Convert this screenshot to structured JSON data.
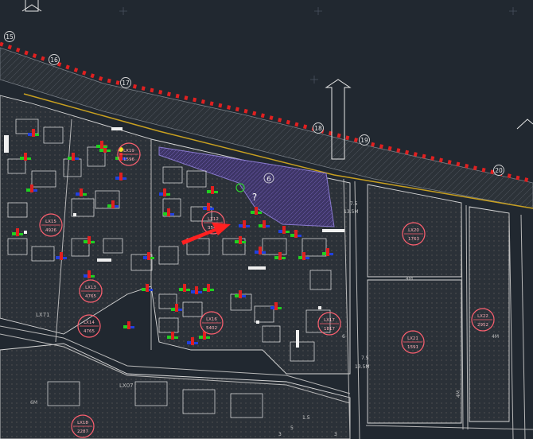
{
  "colors": {
    "background": "#212830",
    "linework": "#d8d8d8",
    "redline": "#e02020",
    "road": "#b8b8b8",
    "parcel_hatch": "#3a4046",
    "accent_purple": "#5a4a8a",
    "arrow": "#ff2020",
    "marker_green": "#20d020",
    "marker_blue": "#2040e0",
    "marker_yellow": "#f0e020"
  },
  "river_markers": [
    "15",
    "16",
    "17",
    "18",
    "19",
    "20"
  ],
  "zone_labels": [
    "LX71",
    "LX07",
    "4M",
    "4M",
    "4M",
    "6M"
  ],
  "road_dimensions": [
    "7.5",
    "13.5M",
    "6",
    "1.5",
    "5",
    "3",
    "7.5",
    "13.5M",
    "3"
  ],
  "plan_circles": [
    {
      "id": "c1",
      "code": "LX15",
      "value": "4926"
    },
    {
      "id": "c2",
      "code": "LX12",
      "value": "3548"
    },
    {
      "id": "c3",
      "code": "LX13",
      "value": "4765"
    },
    {
      "id": "c4",
      "code": "LX14",
      "value": "4765"
    },
    {
      "id": "c5",
      "code": "LX16",
      "value": "5402"
    },
    {
      "id": "c6",
      "code": "LX17",
      "value": "1817"
    },
    {
      "id": "c7",
      "code": "LX18",
      "value": "2287"
    },
    {
      "id": "c8",
      "code": "LX19",
      "value": "1596"
    },
    {
      "id": "c9",
      "code": "LX20",
      "value": "1763"
    },
    {
      "id": "c10",
      "code": "LX21",
      "value": "1591"
    },
    {
      "id": "c11",
      "code": "LX22",
      "value": "2952"
    }
  ],
  "annotation": {
    "number": "6",
    "question_mark": "?"
  }
}
